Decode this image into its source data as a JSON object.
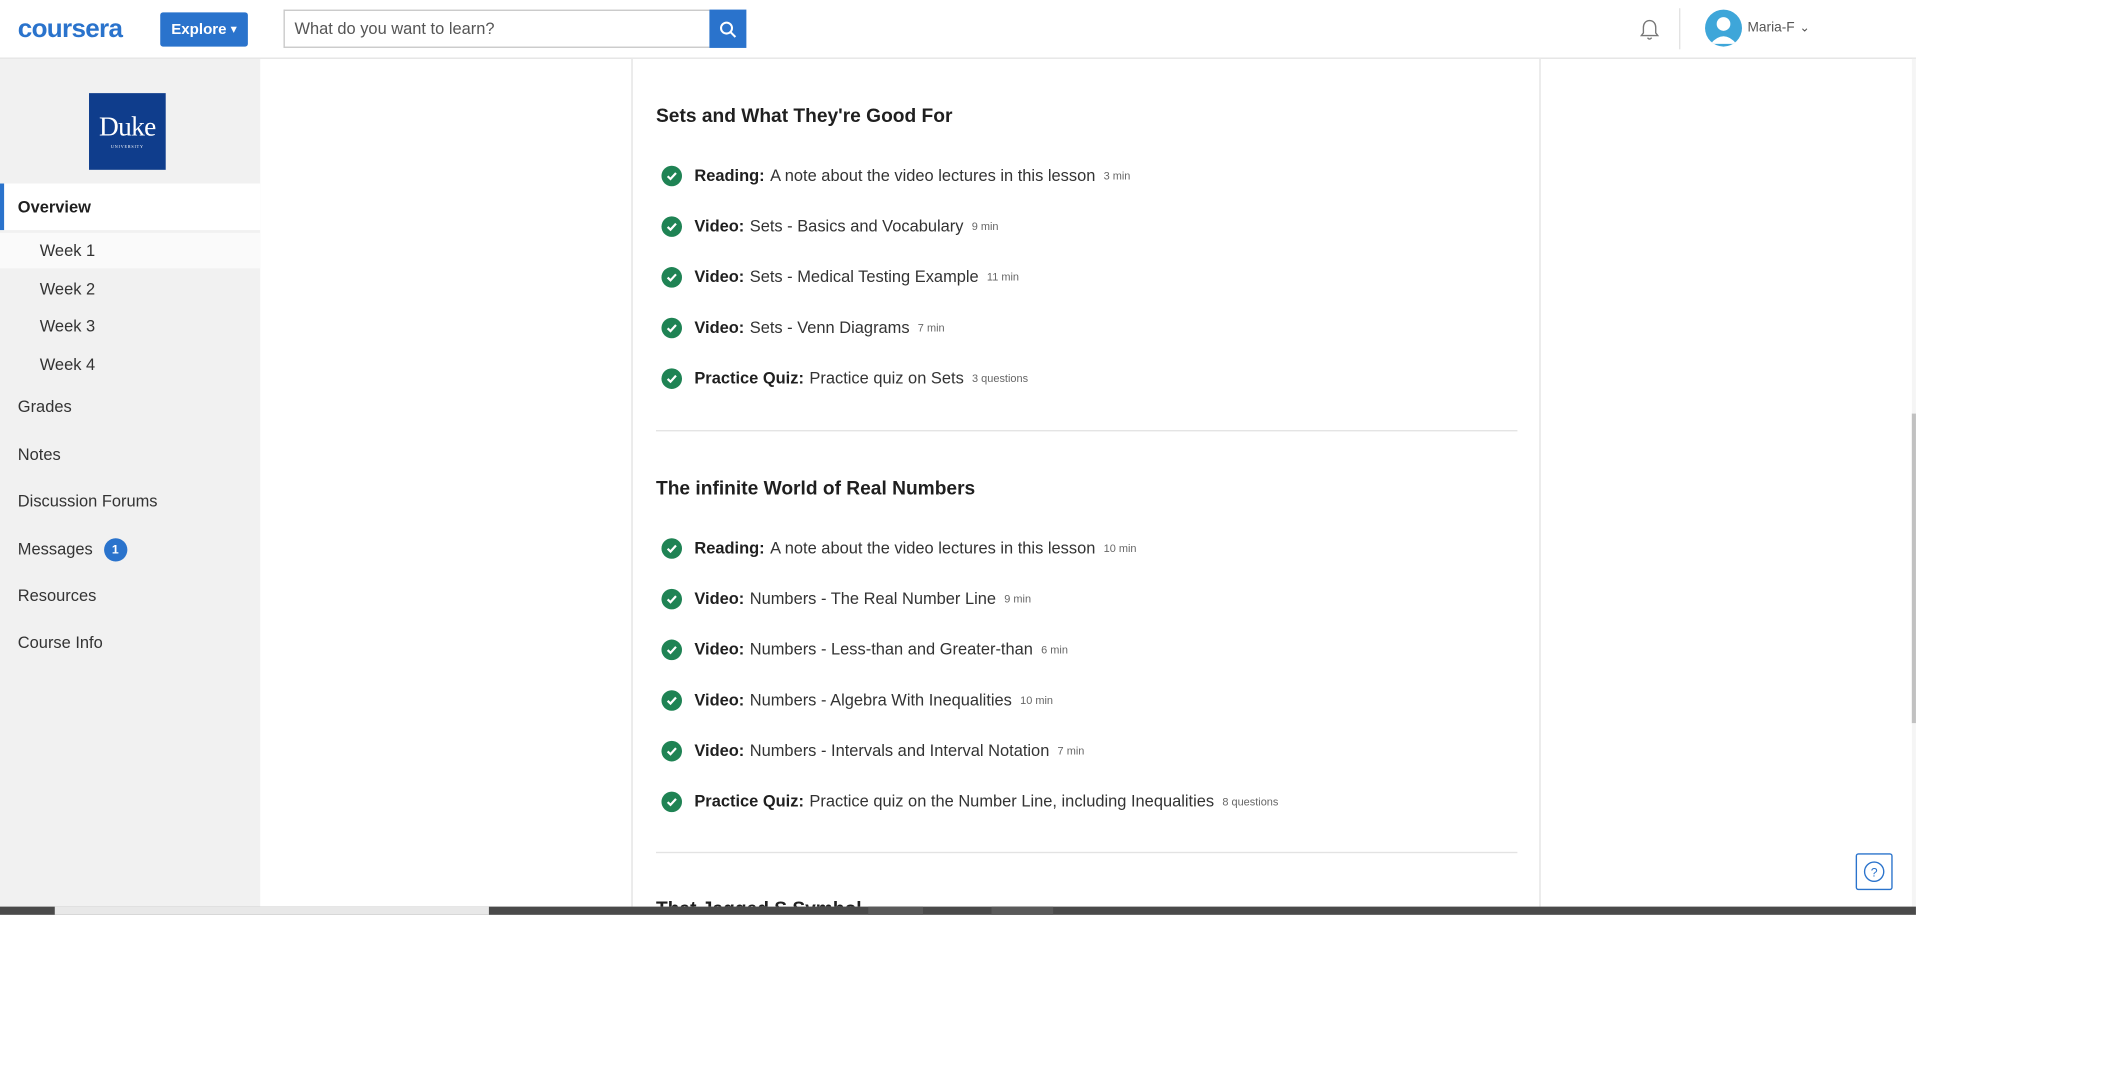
{
  "header": {
    "logo_text": "coursera",
    "explore_label": "Explore",
    "search_placeholder": "What do you want to learn?",
    "username": "Maria-F"
  },
  "sidebar": {
    "university_logo": {
      "name": "Duke",
      "subtitle": "UNIVERSITY"
    },
    "overview_label": "Overview",
    "weeks": [
      "Week 1",
      "Week 2",
      "Week 3",
      "Week 4"
    ],
    "items": {
      "grades": "Grades",
      "notes": "Notes",
      "forums": "Discussion Forums",
      "messages": "Messages",
      "messages_badge": "1",
      "resources": "Resources",
      "course_info": "Course Info"
    }
  },
  "lessons": [
    {
      "title": "Sets and What They're Good For",
      "items": [
        {
          "kind": "Reading:",
          "name": "A note about the video lectures in this lesson",
          "duration": "3 min"
        },
        {
          "kind": "Video:",
          "name": "Sets - Basics and Vocabulary",
          "duration": "9 min"
        },
        {
          "kind": "Video:",
          "name": "Sets - Medical Testing Example",
          "duration": "11 min"
        },
        {
          "kind": "Video:",
          "name": "Sets - Venn Diagrams",
          "duration": "7 min"
        },
        {
          "kind": "Practice Quiz:",
          "name": "Practice quiz on Sets",
          "duration": "3 questions"
        }
      ]
    },
    {
      "title": "The infinite World of Real Numbers",
      "items": [
        {
          "kind": "Reading:",
          "name": "A note about the video lectures in this lesson",
          "duration": "10 min"
        },
        {
          "kind": "Video:",
          "name": "Numbers - The Real Number Line",
          "duration": "9 min"
        },
        {
          "kind": "Video:",
          "name": "Numbers - Less-than and Greater-than",
          "duration": "6 min"
        },
        {
          "kind": "Video:",
          "name": "Numbers - Algebra With Inequalities",
          "duration": "10 min"
        },
        {
          "kind": "Video:",
          "name": "Numbers - Intervals and Interval Notation",
          "duration": "7 min"
        },
        {
          "kind": "Practice Quiz:",
          "name": "Practice quiz on the Number Line, including Inequalities",
          "duration": "8 questions"
        }
      ]
    }
  ],
  "next_lesson_partial_title": "That Jagged S Symbol",
  "colors": {
    "accent": "#2a73cc",
    "complete": "#1f8354",
    "sidebar_bg": "#f1f1f1"
  },
  "icons": {
    "search": "search-icon",
    "bell": "bell-icon",
    "avatar": "avatar-icon",
    "check": "check-circle-icon",
    "help": "help-icon",
    "chevron": "chevron-down-icon"
  }
}
